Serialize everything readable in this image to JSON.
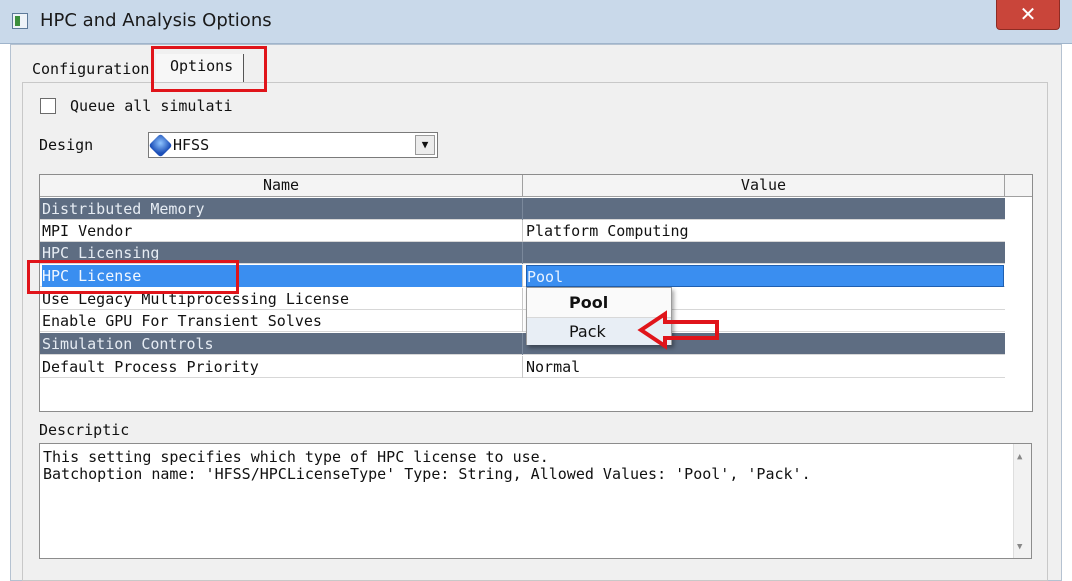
{
  "window": {
    "title": "HPC and Analysis Options",
    "close_glyph": "✕"
  },
  "tabs": [
    {
      "label": "Configuration"
    },
    {
      "label": "Options"
    }
  ],
  "options": {
    "queue_label": "Queue all simulati",
    "queue_checked": false,
    "design_label": "Design",
    "design_value": "HFSS"
  },
  "grid": {
    "headers": {
      "name": "Name",
      "value": "Value"
    },
    "rows": [
      {
        "name": "Distributed Memory",
        "value": "",
        "group": true
      },
      {
        "name": "MPI Vendor",
        "value": "Platform Computing"
      },
      {
        "name": "HPC Licensing",
        "value": "",
        "group": true
      },
      {
        "name": "HPC License",
        "value": "Pool",
        "selected": true
      },
      {
        "name": "Use Legacy Multiprocessing License",
        "value": ""
      },
      {
        "name": "Enable GPU For Transient Solves",
        "value": ""
      },
      {
        "name": "Simulation Controls",
        "value": "",
        "group": true
      },
      {
        "name": "Default Process Priority",
        "value": "Normal"
      }
    ]
  },
  "dropdown": {
    "options": [
      "Pool",
      "Pack"
    ],
    "highlighted": "Pack"
  },
  "description": {
    "label": "Descriptic",
    "lines": [
      "This setting specifies which type of HPC license to use.",
      "Batchoption name: 'HFSS/HPCLicenseType' Type: String, Allowed Values: 'Pool', 'Pack'."
    ]
  },
  "colors": {
    "annotation": "#e0141a",
    "group_row": "#5e6d82",
    "selection": "#3a8ef0"
  }
}
